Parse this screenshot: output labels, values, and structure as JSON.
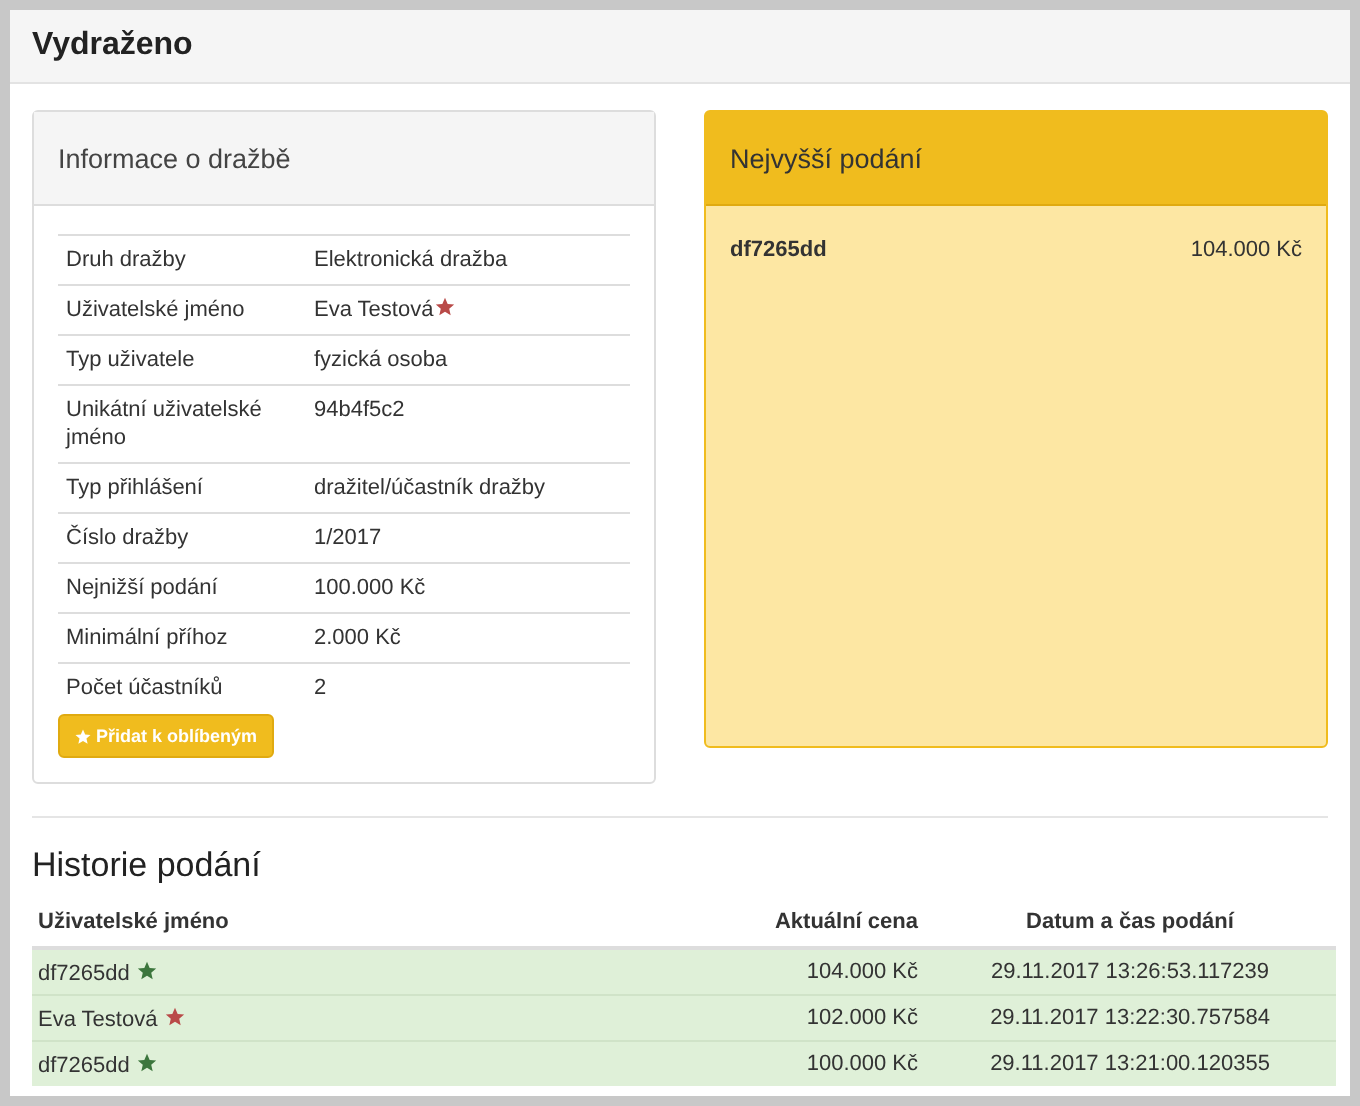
{
  "page_title": "Vydraženo",
  "info_panel": {
    "title": "Informace o dražbě",
    "rows": [
      {
        "label": "Druh dražby",
        "value": "Elektronická dražba"
      },
      {
        "label": "Uživatelské jméno",
        "value": "Eva Testová",
        "color": "#b94a48"
      },
      {
        "label": "Typ uživatele",
        "value": "fyzická osoba"
      },
      {
        "label": "Unikátní uživatelské jméno",
        "value": "94b4f5c2"
      },
      {
        "label": "Typ přihlášení",
        "value": "dražitel/účastník dražby"
      },
      {
        "label": "Číslo dražby",
        "value": "1/2017"
      },
      {
        "label": "Nejnižší podání",
        "value": "100.000 Kč"
      },
      {
        "label": "Minimální příhoz",
        "value": "2.000 Kč"
      },
      {
        "label": "Počet účastníků",
        "value": "2"
      }
    ],
    "favorite_button": "Přidat k oblíbeným"
  },
  "highest_bid": {
    "title": "Nejvyšší podání",
    "user": "df7265dd",
    "amount": "104.000 Kč"
  },
  "history": {
    "title": "Historie podání",
    "columns": [
      "Uživatelské jméno",
      "Aktuální cena",
      "Datum a čas podání"
    ],
    "rows": [
      {
        "user": "df7265dd",
        "color": "#3c763d",
        "price": "104.000 Kč",
        "time": "29.11.2017 13:26:53.117239"
      },
      {
        "user": "Eva Testová",
        "color": "#b94a48",
        "price": "102.000 Kč",
        "time": "29.11.2017 13:22:30.757584"
      },
      {
        "user": "df7265dd",
        "color": "#3c763d",
        "price": "100.000 Kč",
        "time": "29.11.2017 13:21:00.120355"
      }
    ]
  }
}
